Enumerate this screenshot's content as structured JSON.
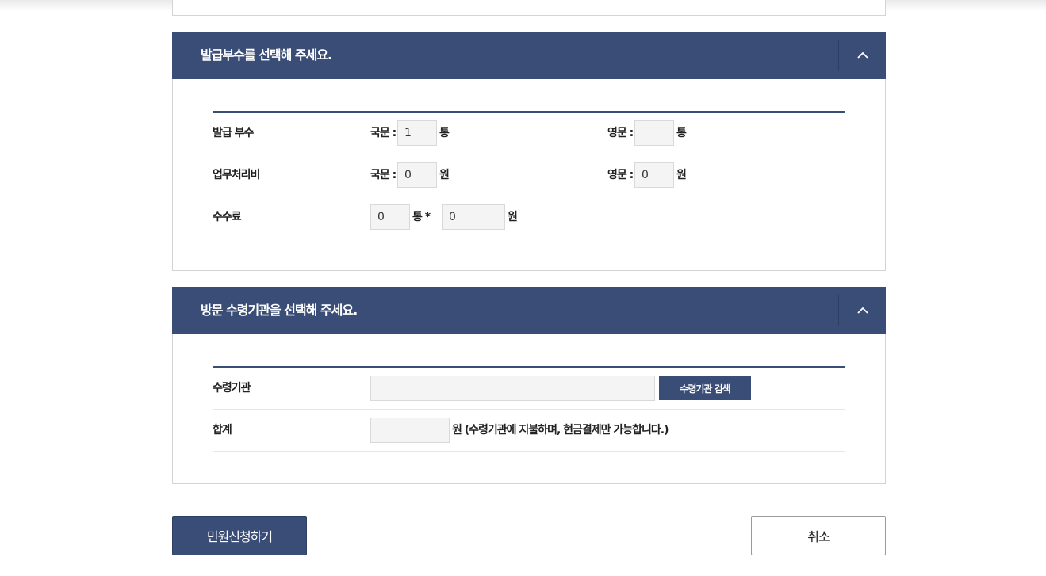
{
  "section_copies": {
    "title": "발급부수를 선택해 주세요.",
    "toggle_icon": "chevron-up-icon",
    "rows": {
      "copies": {
        "label": "발급 부수",
        "korean_label": "국문 :",
        "korean_value": "1",
        "korean_unit": "통",
        "english_label": "영문 :",
        "english_value": "",
        "english_unit": "통"
      },
      "handling_fee": {
        "label": "업무처리비",
        "korean_label": "국문 :",
        "korean_value": "0",
        "korean_unit": "원",
        "english_label": "영문 :",
        "english_value": "0",
        "english_unit": "원"
      },
      "fee": {
        "label": "수수료",
        "count_value": "0",
        "count_unit": "통 *",
        "amount_value": "0",
        "amount_unit": "원"
      }
    }
  },
  "section_agency": {
    "title": "방문 수령기관을 선택해 주세요.",
    "toggle_icon": "chevron-up-icon",
    "rows": {
      "agency": {
        "label": "수령기관",
        "value": "",
        "search_button": "수령기관 검색"
      },
      "total": {
        "label": "합계",
        "value": "",
        "note": "원 (수령기관에 지불하며, 현금결제만 가능합니다.)"
      }
    }
  },
  "actions": {
    "submit": "민원신청하기",
    "cancel": "취소"
  },
  "colors": {
    "header_bg": "#3a4d76",
    "field_bg": "#f4f4f4"
  }
}
